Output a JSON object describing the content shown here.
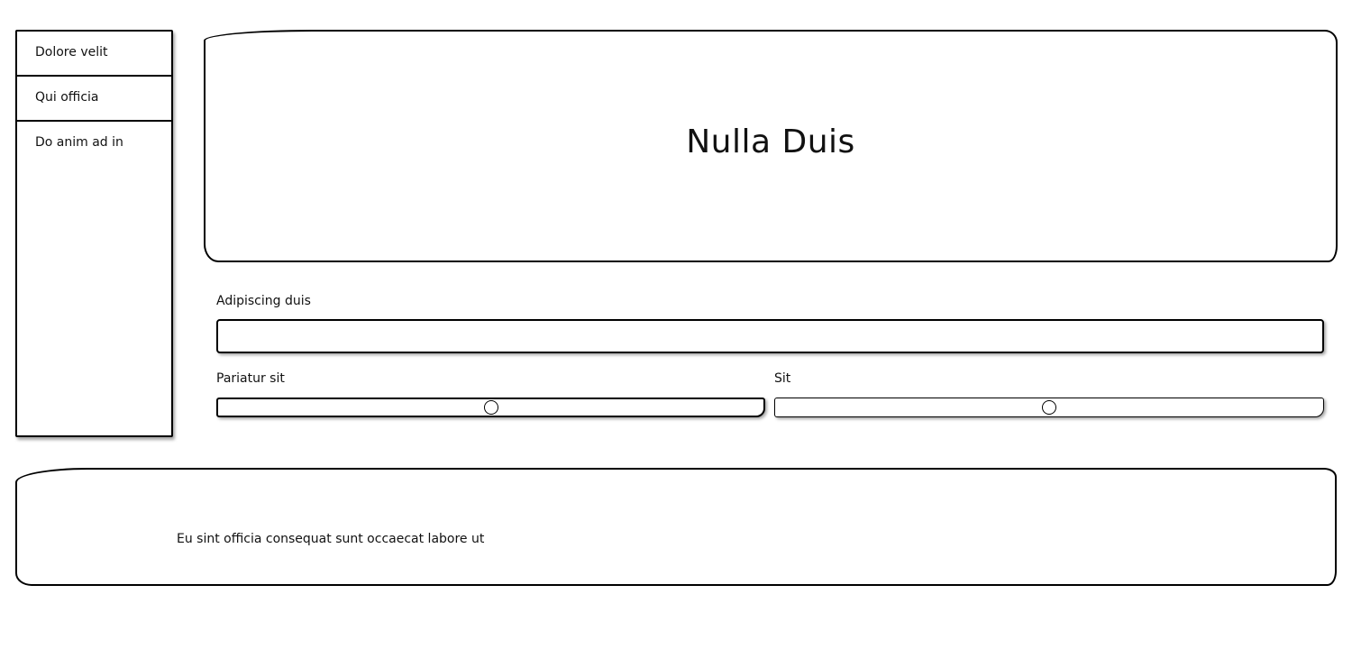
{
  "sidebar": {
    "items": [
      {
        "label": "Dolore velit"
      },
      {
        "label": "Qui officia"
      },
      {
        "label": "Do anim ad in"
      }
    ]
  },
  "header": {
    "title": "Nulla Duis"
  },
  "form": {
    "text_field": {
      "label": "Adipiscing duis",
      "value": "",
      "placeholder": ""
    },
    "slider_1": {
      "label": "Pariatur sit",
      "value": 0.5
    },
    "slider_2": {
      "label": "Sit",
      "value": 0.5
    }
  },
  "footer": {
    "text": "Eu sint officia consequat sunt occaecat labore ut"
  }
}
